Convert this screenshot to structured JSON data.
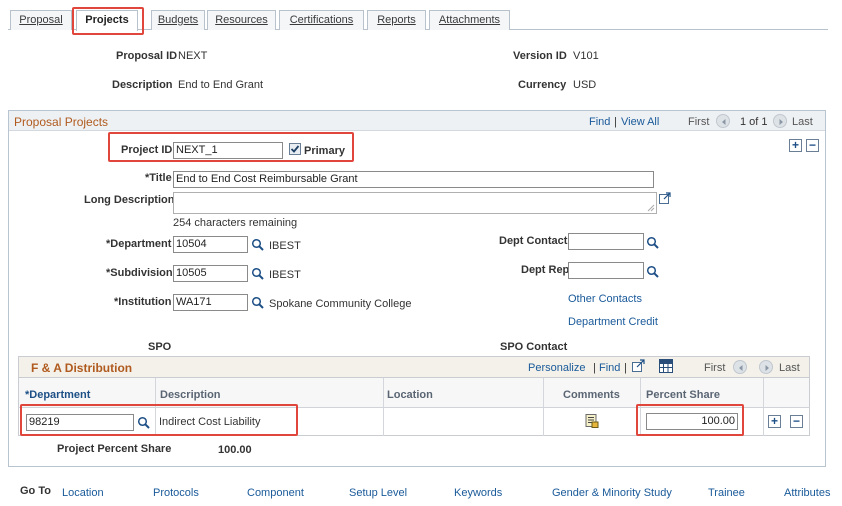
{
  "tabs": [
    {
      "label": "Proposal"
    },
    {
      "label": "Projects"
    },
    {
      "label": "Budgets"
    },
    {
      "label": "Resources"
    },
    {
      "label": "Certifications"
    },
    {
      "label": "Reports"
    },
    {
      "label": "Attachments"
    }
  ],
  "header": {
    "proposal_id_label": "Proposal ID",
    "proposal_id_value": "NEXT",
    "version_id_label": "Version ID",
    "version_id_value": "V101",
    "description_label": "Description",
    "description_value": "End to End Grant",
    "currency_label": "Currency",
    "currency_value": "USD"
  },
  "proposal_projects": {
    "title": "Proposal Projects",
    "find": "Find",
    "sep": "|",
    "view_all": "View All",
    "first": "First",
    "count": "1 of 1",
    "last": "Last",
    "project_id_label": "Project ID",
    "project_id_value": "NEXT_1",
    "primary_label": "Primary",
    "title_label": "*Title",
    "title_value": "End to End Cost Reimbursable Grant",
    "long_desc_label": "Long Description",
    "chars_remaining": "254 characters remaining",
    "department_label": "*Department",
    "department_value": "10504",
    "department_desc": "IBEST",
    "subdivision_label": "*Subdivision",
    "subdivision_value": "10505",
    "subdivision_desc": "IBEST",
    "institution_label": "*Institution",
    "institution_value": "WA171",
    "institution_desc": "Spokane Community College",
    "dept_contact_label": "Dept Contact",
    "dept_rep_label": "Dept Rep",
    "other_contacts": "Other Contacts",
    "department_credit": "Department Credit",
    "spo_label": "SPO",
    "spo_contact_label": "SPO Contact"
  },
  "fa_distribution": {
    "title": "F & A Distribution",
    "personalize": "Personalize",
    "find": "Find",
    "first": "First",
    "last": "Last",
    "columns": [
      "*Department",
      "Description",
      "Location",
      "Comments",
      "Percent Share"
    ],
    "row": {
      "department": "98219",
      "description": "Indirect Cost Liability",
      "percent": "100.00"
    }
  },
  "project_percent": {
    "label": "Project Percent Share",
    "value": "100.00"
  },
  "goto": {
    "label": "Go To",
    "links": [
      "Location",
      "Protocols",
      "Component",
      "Setup Level",
      "Keywords",
      "Gender & Minority Study",
      "Trainee",
      "Attributes"
    ]
  },
  "colors": {
    "highlight": "#e0463c",
    "section_title": "#b05a1e",
    "link": "#1a5a9a"
  }
}
